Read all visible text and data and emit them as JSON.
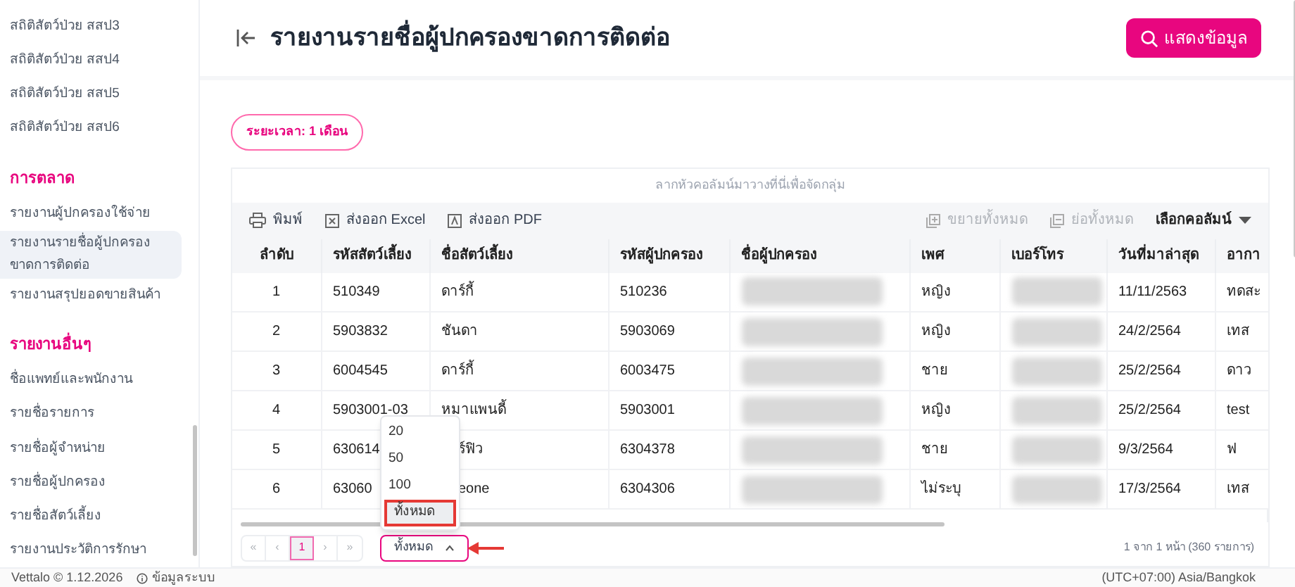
{
  "sidebar": {
    "items": [
      {
        "kind": "link",
        "label": "สถิติสัตว์ป่วย สสป3",
        "selected": false
      },
      {
        "kind": "link",
        "label": "สถิติสัตว์ป่วย สสป4",
        "selected": false
      },
      {
        "kind": "link",
        "label": "สถิติสัตว์ป่วย สสป5",
        "selected": false
      },
      {
        "kind": "link",
        "label": "สถิติสัตว์ป่วย สสป6",
        "selected": false
      },
      {
        "kind": "heading",
        "label": "การตลาด"
      },
      {
        "kind": "link",
        "label": "รายงานผู้ปกครองใช้จ่าย",
        "selected": false
      },
      {
        "kind": "link",
        "label": "รายงานรายชื่อผู้ปกครองขาดการติดต่อ",
        "selected": true
      },
      {
        "kind": "link",
        "label": "รายงานสรุปยอดขายสินค้า",
        "selected": false
      },
      {
        "kind": "heading",
        "label": "รายงานอื่นๆ"
      },
      {
        "kind": "link",
        "label": "ชื่อแพทย์และพนักงาน",
        "selected": false
      },
      {
        "kind": "link",
        "label": "รายชื่อรายการ",
        "selected": false
      },
      {
        "kind": "link",
        "label": "รายชื่อผู้จำหน่าย",
        "selected": false
      },
      {
        "kind": "link",
        "label": "รายชื่อผู้ปกครอง",
        "selected": false
      },
      {
        "kind": "link",
        "label": "รายชื่อสัตว์เลี้ยง",
        "selected": false
      },
      {
        "kind": "link",
        "label": "รายงานประวัติการรักษา",
        "selected": false
      }
    ]
  },
  "header": {
    "title": "รายงานรายชื่อผู้ปกครองขาดการติดต่อ",
    "show_button": "แสดงข้อมูล"
  },
  "filter_badge": "ระยะเวลา: 1 เดือน",
  "table": {
    "group_hint": "ลากหัวคอลัมน์มาวางที่นี่เพื่อจัดกลุ่ม",
    "toolbar_left": [
      {
        "kind": "print",
        "label": "พิมพ์"
      },
      {
        "kind": "excel",
        "label": "ส่งออก Excel"
      },
      {
        "kind": "pdf",
        "label": "ส่งออก PDF"
      }
    ],
    "toolbar_right": [
      {
        "kind": "expand",
        "label": "ขยายทั้งหมด",
        "disabled": true
      },
      {
        "kind": "collapse",
        "label": "ย่อทั้งหมด",
        "disabled": true
      },
      {
        "kind": "columns",
        "label": "เลือกคอลัมน์",
        "disabled": false
      }
    ],
    "columns": [
      "ลำดับ",
      "รหัสสัตว์เลี้ยง",
      "ชื่อสัตว์เลี้ยง",
      "รหัสผู้ปกครอง",
      "ชื่อผู้ปกครอง",
      "เพศ",
      "เบอร์โทร",
      "วันที่มาล่าสุด",
      "อากา"
    ],
    "rows": [
      [
        "1",
        "510349",
        "ดาร์กี้",
        "510236",
        {
          "kind": "blurred"
        },
        "หญิง",
        {
          "kind": "blurred"
        },
        "11/11/2563",
        "ทดสะ"
      ],
      [
        "2",
        "5903832",
        "ชันดา",
        "5903069",
        {
          "kind": "blurred"
        },
        "หญิง",
        {
          "kind": "blurred"
        },
        "24/2/2564",
        "เทส"
      ],
      [
        "3",
        "6004545",
        "ดาร์กี้",
        "6003475",
        {
          "kind": "blurred"
        },
        "ชาย",
        {
          "kind": "blurred"
        },
        "25/2/2564",
        "ดาว"
      ],
      [
        "4",
        "5903001-03",
        "หมาแพนดี้",
        "5903001",
        {
          "kind": "blurred"
        },
        "หญิง",
        {
          "kind": "blurred"
        },
        "25/2/2564",
        "test"
      ],
      [
        "5",
        "630614",
        "ร์ฟิว",
        "6304378",
        {
          "kind": "blurred"
        },
        "ชาย",
        {
          "kind": "blurred"
        },
        "9/3/2564",
        "ฟ"
      ],
      [
        "6",
        "63060",
        "eone",
        "6304306",
        {
          "kind": "blurred"
        },
        "ไม่ระบุ",
        {
          "kind": "blurred"
        },
        "17/3/2564",
        "เทส"
      ]
    ]
  },
  "pagination": {
    "buttons": [
      {
        "label": "«",
        "selected": false
      },
      {
        "label": "‹",
        "selected": false
      },
      {
        "label": "1",
        "selected": true
      },
      {
        "label": "›",
        "selected": false
      },
      {
        "label": "»",
        "selected": false
      }
    ],
    "page_size": {
      "value": "ทั้งหมด",
      "expanded": true,
      "options": [
        {
          "label": "20",
          "selected": false
        },
        {
          "label": "50",
          "selected": false
        },
        {
          "label": "100",
          "selected": false
        },
        {
          "label": "ทั้งหมด",
          "selected": true
        }
      ]
    },
    "summary": "1 จาก 1 หน้า (360 รายการ)"
  },
  "footer": {
    "left": "Vettalo © 1.12.2026",
    "info": "ข้อมูลระบบ",
    "right": "(UTC+07:00) Asia/Bangkok"
  }
}
